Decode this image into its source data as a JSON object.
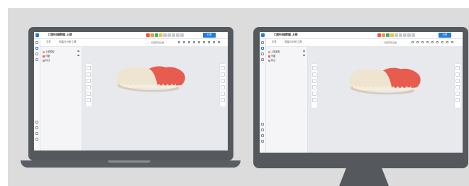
{
  "app": {
    "title": "口腔扫描数据-上颌",
    "tabs": [
      "文件",
      "测量与分析工具"
    ],
    "status": "已保存到云端",
    "share_label": "分享",
    "toolbar_buttons": [
      {
        "icon": "undo-icon",
        "color": "#e8584a"
      },
      {
        "icon": "model-icon",
        "color": "#f29a36"
      },
      {
        "icon": "gum-icon",
        "color": "#3fb26e"
      },
      {
        "icon": "tooth-icon",
        "color": "#f2c437"
      },
      {
        "icon": "grid-icon",
        "color": "#9aa0a8"
      },
      {
        "icon": "measure-icon",
        "color": "#9aa0a8"
      },
      {
        "icon": "section-icon",
        "color": "#9aa0a8"
      },
      {
        "icon": "annotate-icon",
        "color": "#9aa0a8"
      },
      {
        "icon": "compare-icon",
        "color": "#9aa0a8"
      }
    ],
    "tree": [
      {
        "label": "上颌模型",
        "color": "#e8a07d"
      },
      {
        "label": "牙龈",
        "color": "#e85b4f"
      },
      {
        "label": "标注",
        "color": "#9aa0a8"
      }
    ]
  },
  "devices": {
    "laptop": {
      "name": "laptop"
    },
    "monitor": {
      "name": "monitor"
    }
  },
  "colors": {
    "accent": "#1e7ae6",
    "gum": "#e85b4f",
    "tooth": "#f0e6d2",
    "bezel": "#55595d",
    "background": "#dcdcdc"
  }
}
